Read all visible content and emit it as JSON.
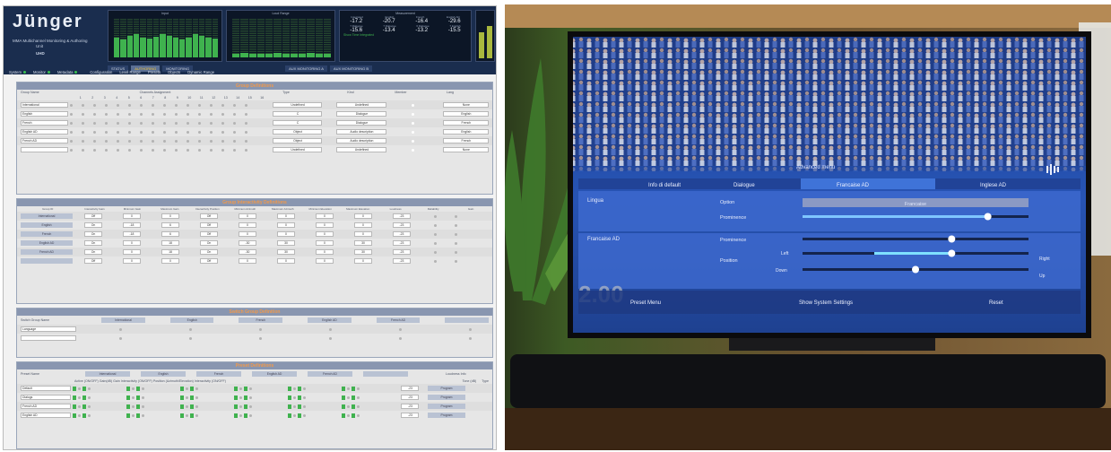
{
  "left_ui": {
    "logo": "Jünger",
    "subtitle": "MMA Multichannel Monitoring & Authoring",
    "subtitle2": "Unit",
    "model": "UHD",
    "meters": {
      "input_title": "Input",
      "loud_title": "Loud Range",
      "input_levels": [
        0.5,
        0.45,
        0.55,
        0.6,
        0.5,
        0.48,
        0.52,
        0.58,
        0.55,
        0.5,
        0.45,
        0.5,
        0.6,
        0.55,
        0.5,
        0.48
      ],
      "loud_levels": [
        0.1,
        0.12,
        0.1,
        0.08,
        0.1,
        0.12,
        0.1,
        0.1,
        0.08,
        0.12,
        0.1,
        0.1
      ]
    },
    "measurement": {
      "title": "Measurement",
      "labels1": [
        "Integrated",
        "English",
        "French",
        "English AD"
      ],
      "values1": [
        "-17.2",
        "-20.7",
        "-16.4",
        "-29.6"
      ],
      "labels2": [
        "7 Dialogue",
        "7 Dialogue",
        "6 Dialogue",
        "7 English"
      ],
      "values2": [
        "-15.6",
        "-13.4",
        "-13.2",
        "-15.5"
      ],
      "status": "Show Time   Integrated",
      "right_levels": [
        0.55,
        0.7
      ]
    },
    "top_tabs": [
      {
        "label": "STATUS",
        "on": false
      },
      {
        "label": "AUTHORING",
        "on": true
      },
      {
        "label": "MONITORING",
        "on": false
      },
      {
        "label": "AUX MONITORING A",
        "on": false
      },
      {
        "label": "AUX MONITORING B",
        "on": false
      }
    ],
    "menu": [
      "System",
      "Monitor",
      "Metadata",
      "Configuration",
      "Level Range",
      "Presets",
      "Objects",
      "Dynamic Range"
    ],
    "group_def": {
      "title": "Group Definitions",
      "col_group": "Group Name",
      "col_channels": "Channels Assignment",
      "col_type": "Type",
      "col_kind": "Kind",
      "col_member": "Member",
      "col_lang": "Lang",
      "channel_numbers": [
        "1",
        "2",
        "3",
        "4",
        "5",
        "6",
        "7",
        "8",
        "9",
        "10",
        "11",
        "12",
        "13",
        "14",
        "15",
        "16"
      ],
      "rows": [
        {
          "name": "International",
          "type": "Undefined",
          "kind": "Undefined",
          "lang": "None"
        },
        {
          "name": "English",
          "type": "C",
          "kind": "Dialogue",
          "lang": "English"
        },
        {
          "name": "French",
          "type": "C",
          "kind": "Dialogue",
          "lang": "French"
        },
        {
          "name": "English AD",
          "type": "Object",
          "kind": "Audio description",
          "lang": "English"
        },
        {
          "name": "French AD",
          "type": "Object",
          "kind": "Audio description",
          "lang": "French"
        },
        {
          "name": "",
          "type": "Undefined",
          "kind": "Undefined",
          "lang": "None"
        }
      ]
    },
    "inter_def": {
      "title": "Group Interactivity Definitions",
      "headers": [
        "Group ID",
        "Interactivity Gain",
        "Minimum Gain",
        "Maximum Gain",
        "Interactivity Position",
        "Minimum Azimuth",
        "Maximum Azimuth",
        "Minimum Elevation",
        "Maximum Elevation",
        "Loudness",
        "Reliability",
        "Gain"
      ],
      "rows": [
        {
          "name": "International",
          "vals": [
            "Off",
            "0",
            "0",
            "Off",
            "0",
            "0",
            "0",
            "0",
            "-23"
          ]
        },
        {
          "name": "English",
          "vals": [
            "On",
            "-18",
            "6",
            "Off",
            "0",
            "0",
            "0",
            "0",
            "-23"
          ]
        },
        {
          "name": "French",
          "vals": [
            "On",
            "-18",
            "6",
            "Off",
            "0",
            "0",
            "0",
            "0",
            "-23"
          ]
        },
        {
          "name": "English AD",
          "vals": [
            "On",
            "0",
            "18",
            "On",
            "-30",
            "30",
            "0",
            "30",
            "-23"
          ]
        },
        {
          "name": "French AD",
          "vals": [
            "On",
            "0",
            "18",
            "On",
            "-30",
            "30",
            "0",
            "30",
            "-23"
          ]
        },
        {
          "name": "",
          "vals": [
            "Off",
            "0",
            "0",
            "Off",
            "0",
            "0",
            "0",
            "0",
            "-23"
          ]
        }
      ]
    },
    "switch_def": {
      "title": "Switch Group Definition",
      "col": "Switch Group Name",
      "buttons": [
        "International",
        "English",
        "French",
        "English AD",
        "French AD",
        ""
      ],
      "rows": [
        "Language",
        ""
      ]
    },
    "preset_def": {
      "title": "Preset Definitions",
      "col": "Preset Name",
      "buttons": [
        "International",
        "English",
        "French",
        "English AD",
        "French AD",
        ""
      ],
      "loud_info": "Loudness Info",
      "subhead": "Active (ON/OFF)   Gain(dB)   Gain Interactivity (ON/OFF)   Position (Azimuth/Elevation)   Interactivity (ON/OFF)",
      "col_tone": "Tone (dB)",
      "col_type": "Type",
      "rows": [
        {
          "name": "Default",
          "tone": "-23",
          "type": "Program"
        },
        {
          "name": "Dialogs",
          "tone": "-23",
          "type": "Program"
        },
        {
          "name": "French AD",
          "tone": "-23",
          "type": "Program"
        },
        {
          "name": "English AD",
          "tone": "-23",
          "type": "Program"
        }
      ]
    }
  },
  "tv_menu": {
    "top_label": "Advanced menu",
    "tabs": [
      "Info di default",
      "Dialogue",
      "Francaise AD",
      "Inglese AD"
    ],
    "active_tab": 2,
    "sec1_label": "Lingua",
    "sec1_field": "Option",
    "sec1_value": "Francaise",
    "sec1_prom": "Prominence",
    "sec1_prom_level": 0.82,
    "sec2_label": "Francaise AD",
    "sec2_prom": "Prominence",
    "sec2_prom_level": 0.66,
    "pos_label": "Position",
    "left": "Left",
    "right": "Right",
    "down": "Down",
    "up": "Up",
    "pos_lr_level": 0.66,
    "pos_ud_level": 0.5,
    "bottom": [
      "Preset Menu",
      "Show System Settings",
      "Reset"
    ],
    "scoreboard": "2.00"
  }
}
